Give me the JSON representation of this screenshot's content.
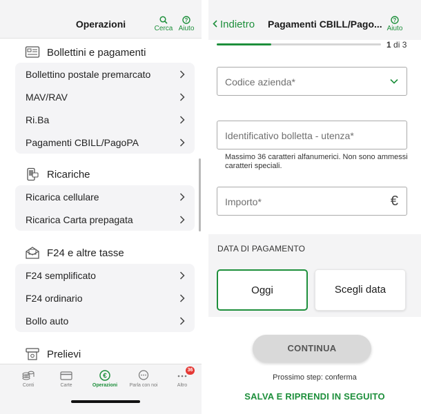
{
  "left_screen": {
    "header": {
      "title": "Operazioni",
      "search_label": "Cerca",
      "help_label": "Aiuto"
    },
    "sections": [
      {
        "title": "Bollettini e pagamenti",
        "icon": "bill-icon",
        "items": [
          "Bollettino postale premarcato",
          "MAV/RAV",
          "Ri.Ba",
          "Pagamenti CBILL/PagoPA"
        ]
      },
      {
        "title": "Ricariche",
        "icon": "phone-card-icon",
        "items": [
          "Ricarica cellulare",
          "Ricarica Carta prepagata"
        ]
      },
      {
        "title": "F24 e altre tasse",
        "icon": "tax-envelope-icon",
        "items": [
          "F24 semplificato",
          "F24 ordinario",
          "Bollo auto"
        ]
      },
      {
        "title": "Prelievi",
        "icon": "atm-icon",
        "items": []
      }
    ],
    "tabbar": {
      "tabs": [
        {
          "label": "Conti",
          "icon": "coins-icon"
        },
        {
          "label": "Carte",
          "icon": "card-icon"
        },
        {
          "label": "Operazioni",
          "icon": "euro-icon",
          "active": true
        },
        {
          "label": "Parla con noi",
          "icon": "chat-icon"
        },
        {
          "label": "Altro",
          "icon": "more-icon",
          "badge": "36"
        }
      ]
    }
  },
  "right_screen": {
    "header": {
      "back_label": "Indietro",
      "title": "Pagamenti CBILL/Pago...",
      "help_label": "Aiuto"
    },
    "progress": {
      "current": "1",
      "separator": "di",
      "total": "3",
      "fraction": 0.333
    },
    "form": {
      "company_code_placeholder": "Codice azienda*",
      "bill_id_placeholder": "Identificativo bolletta - utenza*",
      "bill_id_hint": "Massimo 36 caratteri alfanumerici. Non sono ammessi caratteri speciali.",
      "amount_placeholder": "Importo*",
      "amount_currency": "€"
    },
    "payment_date": {
      "section_title": "DATA DI PAGAMENTO",
      "today_label": "Oggi",
      "choose_label": "Scegli data",
      "selected": "Oggi"
    },
    "continue_label": "CONTINUA",
    "next_step_label": "Prossimo step: conferma",
    "save_later_label": "SALVA E RIPRENDI IN SEGUITO"
  },
  "colors": {
    "accent": "#1d8f3b",
    "badge": "#e53935",
    "panel": "#f4f4f5",
    "disabled_button": "#d9d9d9"
  }
}
